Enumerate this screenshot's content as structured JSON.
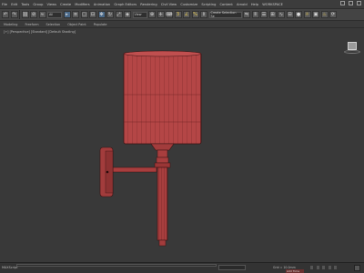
{
  "menu": [
    "File",
    "Edit",
    "Tools",
    "Group",
    "Views",
    "Create",
    "Modifiers",
    "Animation",
    "Graph Editors",
    "Rendering",
    "Civil View",
    "Customize",
    "Scripting",
    "Content",
    "Arnold",
    "Help",
    "WORKSPACE"
  ],
  "toolbar": {
    "filter_value": "All",
    "view_value": "View",
    "selection_set_value": "Create Selection Se"
  },
  "ribbon": {
    "tabs": [
      "Modeling",
      "Freeform",
      "Selection",
      "Object Paint",
      "Populate"
    ]
  },
  "viewport": {
    "label": "[+] [Perspective] [Standard] [Default Shading]",
    "object_color": "#b04040"
  },
  "status": {
    "left_text": "MAXScript",
    "coord_value": "",
    "grid_text": "Grid = 10.0mm",
    "autokey_label": "Add Time Tag"
  },
  "colors": {
    "accent": "#4b6a8a",
    "object": "#b04040",
    "background": "#393939"
  }
}
